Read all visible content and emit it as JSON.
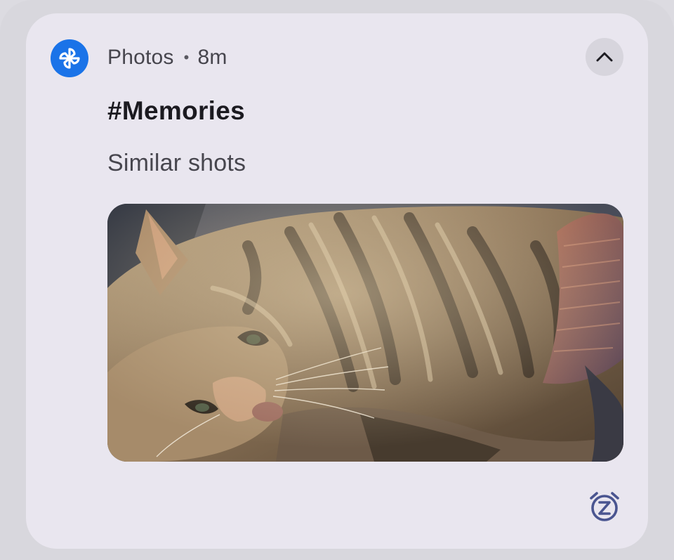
{
  "notification": {
    "app_name": "Photos",
    "separator": "•",
    "time": "8m",
    "title": "#Memories",
    "subtitle": "Similar shots",
    "app_icon": "photos-pinwheel-icon",
    "expand_icon": "chevron-up-icon",
    "snooze_icon": "snooze-alarm-icon",
    "image_subject": "tabby cat lying on a couch",
    "colors": {
      "card_background": "#e9e6ef",
      "app_icon_background": "#1a73e8",
      "snooze_icon": "#4a5590",
      "title_text": "#1b1a20",
      "secondary_text": "#47464e"
    }
  }
}
